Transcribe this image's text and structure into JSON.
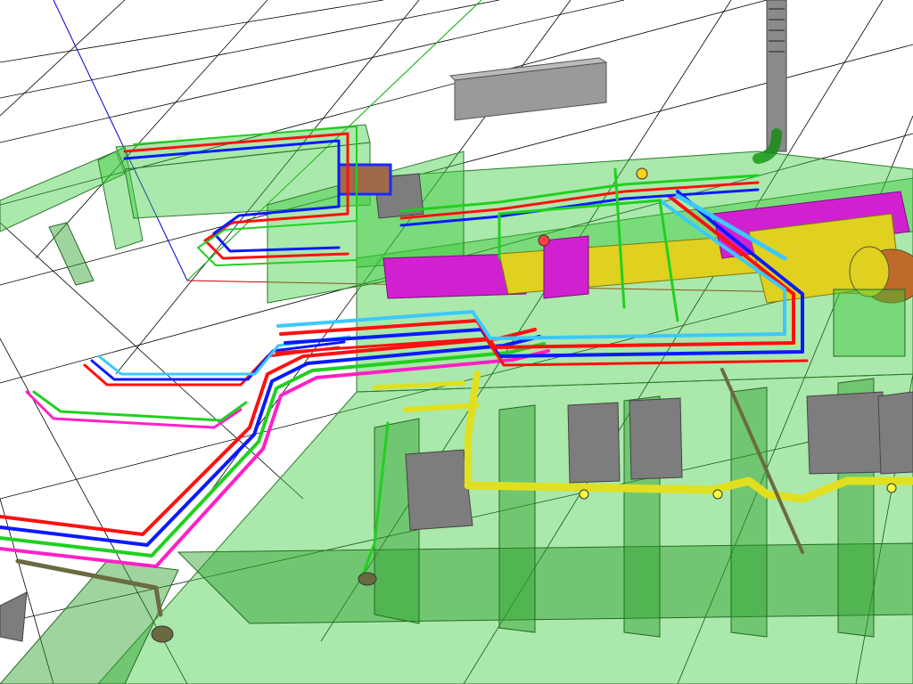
{
  "viewport": {
    "background": "#ffffff"
  },
  "colors": {
    "structure": "#38c838",
    "supply_pipe": "#ff1010",
    "return_pipe": "#0a1aff",
    "chilled_pipe": "#3cc8ff",
    "green_pipe": "#20d020",
    "magenta_pipe": "#ff20c8",
    "duct_magenta": "#d020d0",
    "duct_yellow": "#e0d020",
    "drain_pipe": "#ffff20",
    "sewer_pipe": "#6b6b40",
    "equipment_grey": "#9a9a9a",
    "equipment_orange": "#c06a2a",
    "axis_blue": "#0000cc",
    "axis_green": "#00aa00",
    "axis_red": "#cc0000"
  }
}
